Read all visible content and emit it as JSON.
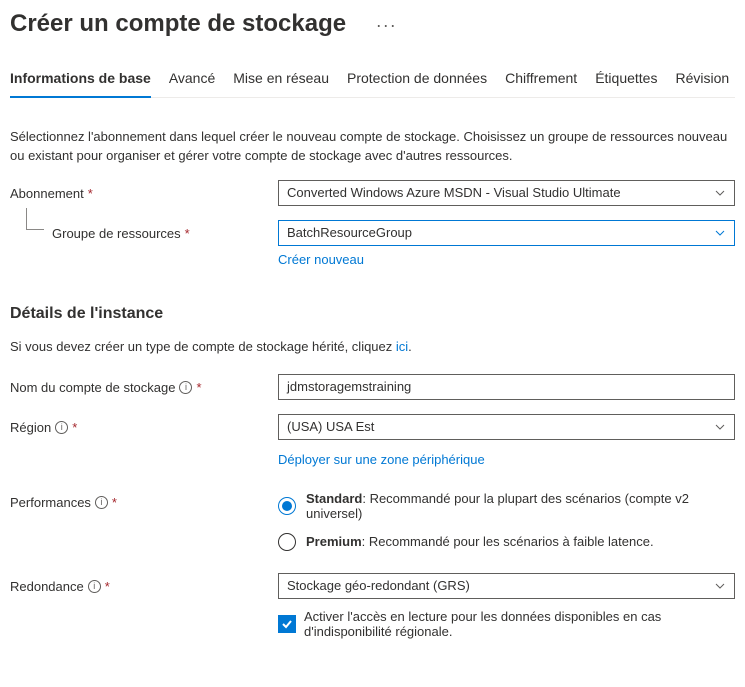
{
  "page": {
    "title": "Créer un compte de stockage"
  },
  "tabs": [
    {
      "label": "Informations de base",
      "active": true
    },
    {
      "label": "Avancé",
      "active": false
    },
    {
      "label": "Mise en réseau",
      "active": false
    },
    {
      "label": "Protection de données",
      "active": false
    },
    {
      "label": "Chiffrement",
      "active": false
    },
    {
      "label": "Étiquettes",
      "active": false
    },
    {
      "label": "Révision",
      "active": false
    }
  ],
  "intro": "Sélectionnez l'abonnement dans lequel créer le nouveau compte de stockage. Choisissez un groupe de ressources nouveau ou existant pour organiser et gérer votre compte de stockage avec d'autres ressources.",
  "subscription": {
    "label": "Abonnement",
    "value": "Converted Windows Azure MSDN - Visual Studio Ultimate"
  },
  "resource_group": {
    "label": "Groupe de ressources",
    "value": "BatchResourceGroup",
    "create_new": "Créer nouveau"
  },
  "instance": {
    "heading": "Détails de l'instance",
    "legacy_hint_prefix": "Si vous devez créer un type de compte de stockage hérité, cliquez ",
    "legacy_hint_link": "ici",
    "legacy_hint_suffix": "."
  },
  "account_name": {
    "label": "Nom du compte de stockage",
    "value": "jdmstoragemstraining"
  },
  "region": {
    "label": "Région",
    "value": "(USA) USA Est",
    "edge_link": "Déployer sur une zone périphérique"
  },
  "performance": {
    "label": "Performances",
    "options": [
      {
        "name": "Standard",
        "desc": ": Recommandé pour la plupart des scénarios (compte v2 universel)",
        "checked": true
      },
      {
        "name": "Premium",
        "desc": ": Recommandé pour les scénarios à faible latence.",
        "checked": false
      }
    ]
  },
  "redundancy": {
    "label": "Redondance",
    "value": "Stockage géo-redondant (GRS)",
    "read_access_label": "Activer l'accès en lecture pour les données disponibles en cas d'indisponibilité régionale."
  }
}
